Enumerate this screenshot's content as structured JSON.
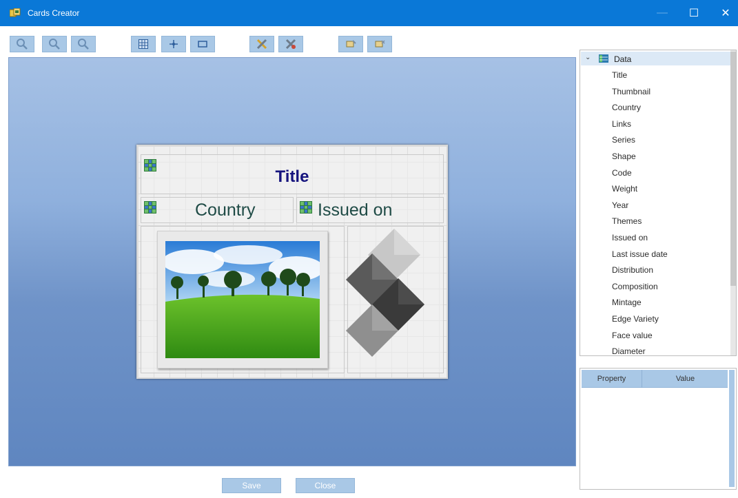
{
  "window": {
    "title": "Cards Creator",
    "controls": {
      "minimize": "—",
      "maximize": "☐",
      "close": "✕"
    }
  },
  "toolbar": {
    "buttons": [
      {
        "name": "zoom-out-icon"
      },
      {
        "name": "zoom-reset-icon"
      },
      {
        "name": "zoom-in-icon"
      },
      {
        "name": "grid-toggle-icon"
      },
      {
        "name": "snap-point-icon"
      },
      {
        "name": "frame-icon"
      },
      {
        "name": "tools-icon"
      },
      {
        "name": "delete-tools-icon"
      },
      {
        "name": "add-field-icon"
      },
      {
        "name": "remove-field-icon"
      }
    ]
  },
  "card": {
    "title": "Title",
    "country": "Country",
    "issued": "Issued on"
  },
  "tree": {
    "root": "Data",
    "items": [
      "Title",
      "Thumbnail",
      "Country",
      "Links",
      "Series",
      "Shape",
      "Code",
      "Weight",
      "Year",
      "Themes",
      "Issued on",
      "Last issue date",
      "Distribution",
      "Composition",
      "Mintage",
      "Edge Variety",
      "Face value",
      "Diameter"
    ]
  },
  "properties": {
    "col_property": "Property",
    "col_value": "Value"
  },
  "buttons": {
    "save": "Save",
    "close": "Close"
  },
  "colors": {
    "titlebar": "#0a78d7",
    "toolbar_button": "#a9c8e6",
    "card_title": "#16147e"
  }
}
